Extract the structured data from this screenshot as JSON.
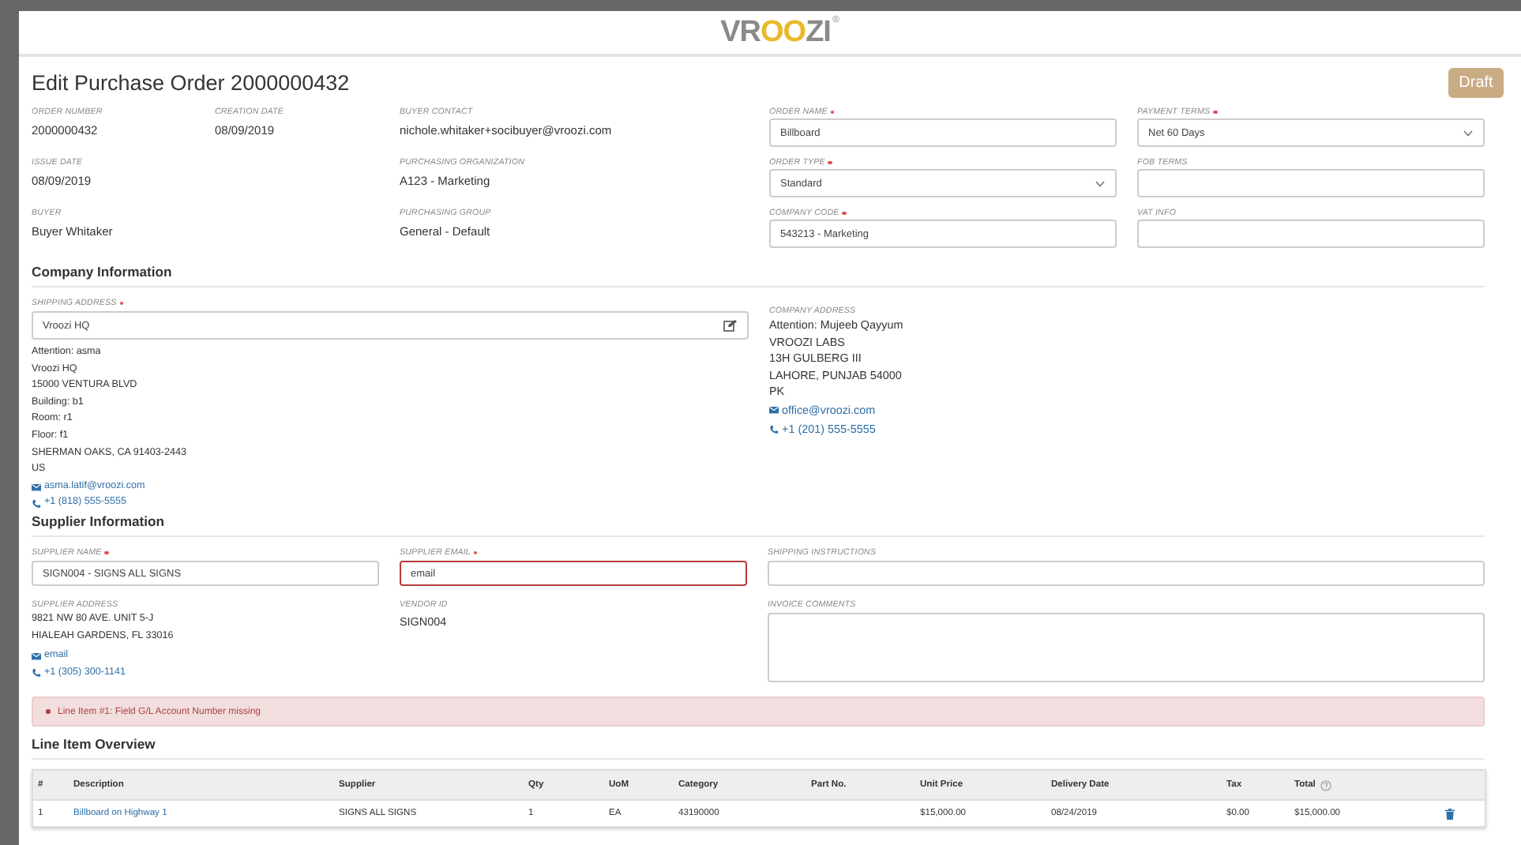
{
  "header": {
    "logo": [
      {
        "text": "VR",
        "accent": false
      },
      {
        "text": "OO",
        "accent": true
      },
      {
        "text": "ZI",
        "accent": false
      }
    ],
    "logo_mark": "®"
  },
  "title": "Edit Purchase Order 2000000432",
  "status_button": "Draft",
  "details": [
    [
      {
        "label": "ORDER NUMBER",
        "value": "2000000432"
      },
      {
        "label": "ISSUE DATE",
        "value": "08/09/2019"
      },
      {
        "label": "BUYER",
        "value": "Buyer Whitaker"
      }
    ],
    [
      {
        "label": "CREATION DATE",
        "value": "08/09/2019"
      }
    ],
    [
      {
        "label": "BUYER CONTACT",
        "value": "nichole.whitaker+socibuyer@vroozi.com"
      },
      {
        "label": "PURCHASING ORGANIZATION",
        "value": "A123 - Marketing"
      },
      {
        "label": "PURCHASING GROUP",
        "value": "General - Default"
      }
    ]
  ],
  "order_fields": [
    [
      {
        "label": "ORDER NAME",
        "required": true,
        "kind": "text",
        "value": "Billboard"
      },
      {
        "label": "ORDER TYPE",
        "required": true,
        "kind": "select",
        "value": "Standard"
      },
      {
        "label": "COMPANY CODE",
        "required": true,
        "kind": "text",
        "value": "543213 - Marketing"
      }
    ],
    [
      {
        "label": "PAYMENT TERMS",
        "required": true,
        "kind": "select",
        "value": "Net 60 Days"
      },
      {
        "label": "FOB TERMS",
        "required": false,
        "kind": "text"
      },
      {
        "label": "VAT INFO",
        "required": false,
        "kind": "text"
      }
    ]
  ],
  "company_information": {
    "heading": "Company Information",
    "shipping_address": {
      "label": "SHIPPING ADDRESS",
      "required": true,
      "kind": "address",
      "value": "Vroozi HQ"
    },
    "shipping_lines": [
      "Attention: asma",
      "Vroozi HQ",
      "15000 VENTURA BLVD",
      "Building: b1",
      "Room: r1",
      "Floor: f1",
      "SHERMAN OAKS, CA 91403-2443",
      "US"
    ],
    "shipping_contacts": [
      {
        "kind": "email",
        "text": "asma.latif@vroozi.com"
      },
      {
        "kind": "phone",
        "text": "+1 (818) 555-5555"
      }
    ],
    "company_address": {
      "label": "COMPANY ADDRESS",
      "lines": [
        "Attention: Mujeeb Qayyum",
        "VROOZI LABS",
        "13H GULBERG III",
        "LAHORE, PUNJAB 54000",
        "PK"
      ],
      "contacts": [
        {
          "kind": "email",
          "text": "office@vroozi.com"
        },
        {
          "kind": "phone",
          "text": "+1 (201) 555-5555"
        }
      ]
    }
  },
  "supplier_information": {
    "heading": "Supplier Information",
    "supplier_name": {
      "label": "SUPPLIER NAME",
      "required": true,
      "kind": "text",
      "value": "SIGN004 - SIGNS ALL SIGNS",
      "invalid": false
    },
    "supplier_email": {
      "label": "SUPPLIER EMAIL",
      "required": true,
      "kind": "text",
      "value": "email",
      "invalid": true
    },
    "shipping_instructions": {
      "label": "SHIPPING INSTRUCTIONS",
      "required": false,
      "kind": "text",
      "invalid": false
    },
    "supplier_address": {
      "label": "SUPPLIER ADDRESS",
      "lines": [
        "9821 NW 80 AVE. UNIT 5-J",
        "HIALEAH GARDENS, FL 33016"
      ],
      "contacts": [
        {
          "kind": "email",
          "text": "email"
        },
        {
          "kind": "phone",
          "text": "+1 (305) 300-1141"
        }
      ]
    },
    "vendor_id": {
      "label": "VENDOR ID",
      "value": "SIGN004"
    },
    "invoice_comments": {
      "label": "INVOICE COMMENTS",
      "required": false,
      "kind": "textarea",
      "invalid": false
    }
  },
  "alerts": [
    "Line Item #1: Field G/L Account Number missing"
  ],
  "line_items": {
    "heading": "Line Item Overview",
    "columns": [
      {
        "label": "#",
        "kind": "text",
        "help": false
      },
      {
        "label": "Description",
        "kind": "link",
        "help": false
      },
      {
        "label": "Supplier",
        "kind": "text",
        "help": false
      },
      {
        "label": "Qty",
        "kind": "text",
        "help": false
      },
      {
        "label": "UoM",
        "kind": "text",
        "help": false
      },
      {
        "label": "Category",
        "kind": "text",
        "help": false
      },
      {
        "label": "Part No.",
        "kind": "text",
        "help": false
      },
      {
        "label": "Unit Price",
        "kind": "text",
        "help": false
      },
      {
        "label": "Delivery Date",
        "kind": "text",
        "help": false
      },
      {
        "label": "Tax",
        "kind": "text",
        "help": false
      },
      {
        "label": "Total",
        "kind": "text",
        "help": true
      }
    ],
    "rows": [
      {
        "cells": [
          "1",
          "Billboard on Highway 1",
          "SIGNS ALL SIGNS",
          "1",
          "EA",
          "43190000",
          "",
          "$15,000.00",
          "08/24/2019",
          "$0.00",
          "$15,000.00"
        ]
      }
    ]
  }
}
